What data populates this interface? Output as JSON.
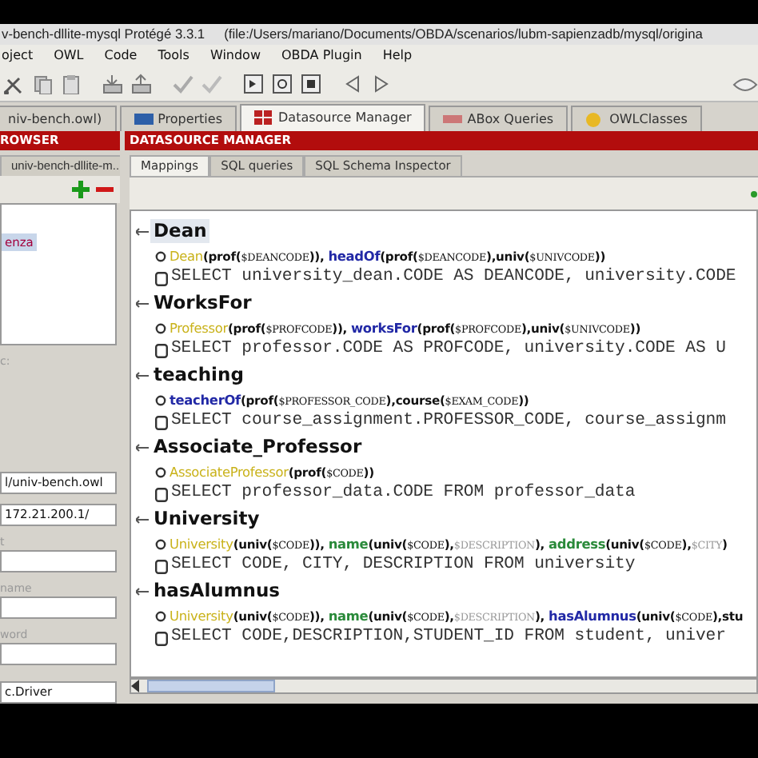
{
  "window": {
    "title": "v-bench-dllite-mysql  Protégé 3.3.1",
    "path": "(file:/Users/mariano/Documents/OBDA/scenarios/lubm-sapienzadb/mysql/origina"
  },
  "menu": [
    "oject",
    "OWL",
    "Code",
    "Tools",
    "Window",
    "OBDA Plugin",
    "Help"
  ],
  "tabs": [
    {
      "label": "niv-bench.owl)",
      "kind": "plain",
      "selected": false
    },
    {
      "label": "Properties",
      "kind": "properties",
      "selected": false
    },
    {
      "label": "Datasource Manager",
      "kind": "datasource",
      "selected": true
    },
    {
      "label": "ABox Queries",
      "kind": "abox",
      "selected": false
    },
    {
      "label": "OWLClasses",
      "kind": "classes",
      "selected": false
    }
  ],
  "left_panel": {
    "header": "ROWSER",
    "subtab": "univ-bench-dllite-m...",
    "list": [
      {
        "label": "enza",
        "selected": true
      }
    ],
    "caption": "c:",
    "fields": [
      {
        "value": "l/univ-bench.owl"
      },
      {
        "value": "172.21.200.1/"
      },
      {
        "label": "t"
      },
      {
        "label": "name"
      },
      {
        "label": "word"
      },
      {
        "value": "c.Driver"
      }
    ]
  },
  "datasource_manager": {
    "header": "DATASOURCE MANAGER",
    "subtabs": [
      {
        "label": "Mappings",
        "selected": true
      },
      {
        "label": "SQL queries",
        "selected": false
      },
      {
        "label": "SQL Schema Inspector",
        "selected": false
      }
    ],
    "mappings": [
      {
        "id_label": "Dean",
        "selected": true,
        "head": [
          {
            "kind": "class",
            "text": "Dean"
          },
          {
            "kind": "term",
            "text": "(prof("
          },
          {
            "kind": "var",
            "text": "$DEANCODE"
          },
          {
            "kind": "term",
            "text": ")), "
          },
          {
            "kind": "objprop",
            "text": "headOf"
          },
          {
            "kind": "term",
            "text": "(prof("
          },
          {
            "kind": "var",
            "text": "$DEANCODE"
          },
          {
            "kind": "term",
            "text": "),univ("
          },
          {
            "kind": "var",
            "text": "$UNIVCODE"
          },
          {
            "kind": "term",
            "text": "))"
          }
        ],
        "sql": "SELECT university_dean.CODE AS DEANCODE, university.CODE"
      },
      {
        "id_label": "WorksFor",
        "selected": false,
        "head": [
          {
            "kind": "class",
            "text": "Professor"
          },
          {
            "kind": "term",
            "text": "(prof("
          },
          {
            "kind": "var",
            "text": "$PROFCODE"
          },
          {
            "kind": "term",
            "text": ")), "
          },
          {
            "kind": "objprop",
            "text": "worksFor"
          },
          {
            "kind": "term",
            "text": "(prof("
          },
          {
            "kind": "var",
            "text": "$PROFCODE"
          },
          {
            "kind": "term",
            "text": "),univ("
          },
          {
            "kind": "var",
            "text": "$UNIVCODE"
          },
          {
            "kind": "term",
            "text": "))"
          }
        ],
        "sql": "SELECT professor.CODE AS PROFCODE, university.CODE AS U"
      },
      {
        "id_label": "teaching",
        "selected": false,
        "head": [
          {
            "kind": "objprop",
            "text": "teacherOf"
          },
          {
            "kind": "term",
            "text": "(prof("
          },
          {
            "kind": "var",
            "text": "$PROFESSOR_CODE"
          },
          {
            "kind": "term",
            "text": "),course("
          },
          {
            "kind": "var",
            "text": "$EXAM_CODE"
          },
          {
            "kind": "term",
            "text": "))"
          }
        ],
        "sql": "SELECT course_assignment.PROFESSOR_CODE, course_assignm"
      },
      {
        "id_label": "Associate_Professor",
        "selected": false,
        "head": [
          {
            "kind": "class",
            "text": "AssociateProfessor"
          },
          {
            "kind": "term",
            "text": "(prof("
          },
          {
            "kind": "var",
            "text": "$CODE"
          },
          {
            "kind": "term",
            "text": "))"
          }
        ],
        "sql": "SELECT professor_data.CODE FROM professor_data"
      },
      {
        "id_label": "University",
        "selected": false,
        "head": [
          {
            "kind": "class",
            "text": "University"
          },
          {
            "kind": "term",
            "text": "(univ("
          },
          {
            "kind": "var",
            "text": "$CODE"
          },
          {
            "kind": "term",
            "text": ")), "
          },
          {
            "kind": "dataprop",
            "text": "name"
          },
          {
            "kind": "term",
            "text": "(univ("
          },
          {
            "kind": "var",
            "text": "$CODE"
          },
          {
            "kind": "term",
            "text": "),"
          },
          {
            "kind": "literal",
            "text": "$DESCRIPTION"
          },
          {
            "kind": "term",
            "text": "), "
          },
          {
            "kind": "dataprop",
            "text": "address"
          },
          {
            "kind": "term",
            "text": "(univ("
          },
          {
            "kind": "var",
            "text": "$CODE"
          },
          {
            "kind": "term",
            "text": "),"
          },
          {
            "kind": "literal",
            "text": "$CITY"
          },
          {
            "kind": "term",
            "text": ")"
          }
        ],
        "sql": "SELECT CODE, CITY, DESCRIPTION FROM university"
      },
      {
        "id_label": "hasAlumnus",
        "selected": false,
        "head": [
          {
            "kind": "class",
            "text": "University"
          },
          {
            "kind": "term",
            "text": "(univ("
          },
          {
            "kind": "var",
            "text": "$CODE"
          },
          {
            "kind": "term",
            "text": ")), "
          },
          {
            "kind": "dataprop",
            "text": "name"
          },
          {
            "kind": "term",
            "text": "(univ("
          },
          {
            "kind": "var",
            "text": "$CODE"
          },
          {
            "kind": "term",
            "text": "),"
          },
          {
            "kind": "literal",
            "text": "$DESCRIPTION"
          },
          {
            "kind": "term",
            "text": "), "
          },
          {
            "kind": "objprop",
            "text": "hasAlumnus"
          },
          {
            "kind": "term",
            "text": "(univ("
          },
          {
            "kind": "var",
            "text": "$CODE"
          },
          {
            "kind": "term",
            "text": "),stu"
          }
        ],
        "sql": "SELECT CODE,DESCRIPTION,STUDENT_ID FROM student, univer"
      }
    ]
  }
}
